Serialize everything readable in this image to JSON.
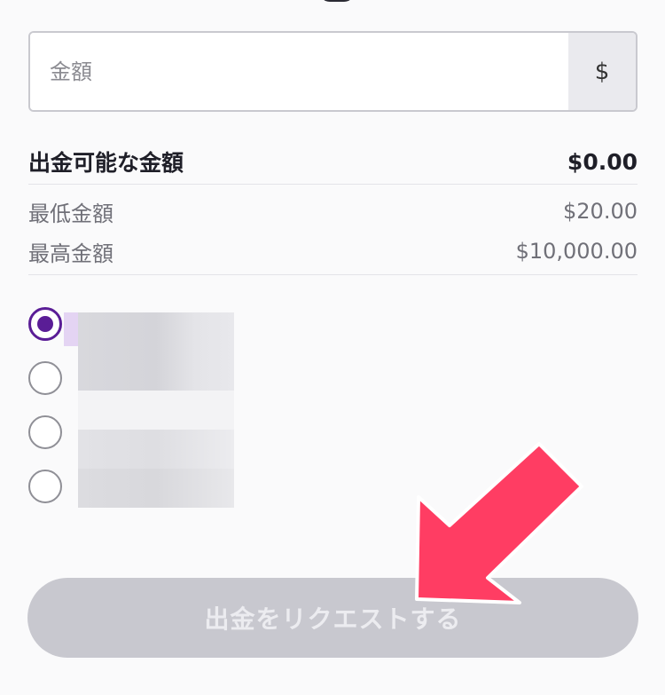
{
  "amount_field": {
    "placeholder": "金額",
    "currency_symbol": "$"
  },
  "summary": {
    "available_label": "出金可能な金額",
    "available_value": "$0.00",
    "min_label": "最低金額",
    "min_value": "$20.00",
    "max_label": "最高金額",
    "max_value": "$10,000.00"
  },
  "methods": [
    {
      "selected": true
    },
    {
      "selected": false
    },
    {
      "selected": false
    },
    {
      "selected": false
    }
  ],
  "submit": {
    "label": "出金をリクエストする"
  },
  "colors": {
    "accent": "#5a1d96",
    "button_disabled": "#c8c8cf",
    "arrow": "#ff3d63"
  }
}
